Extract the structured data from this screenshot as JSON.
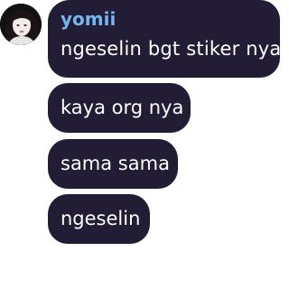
{
  "chat": {
    "sender_name": "yomii",
    "messages": [
      {
        "text": "ngeselin bgt stiker nya"
      },
      {
        "text": "kaya org nya"
      },
      {
        "text": "sama sama"
      },
      {
        "text": "ngeselin"
      }
    ]
  },
  "colors": {
    "bubble_bg": "#221c34",
    "sender_name": "#74b6ee",
    "message_text": "#ffffff"
  }
}
